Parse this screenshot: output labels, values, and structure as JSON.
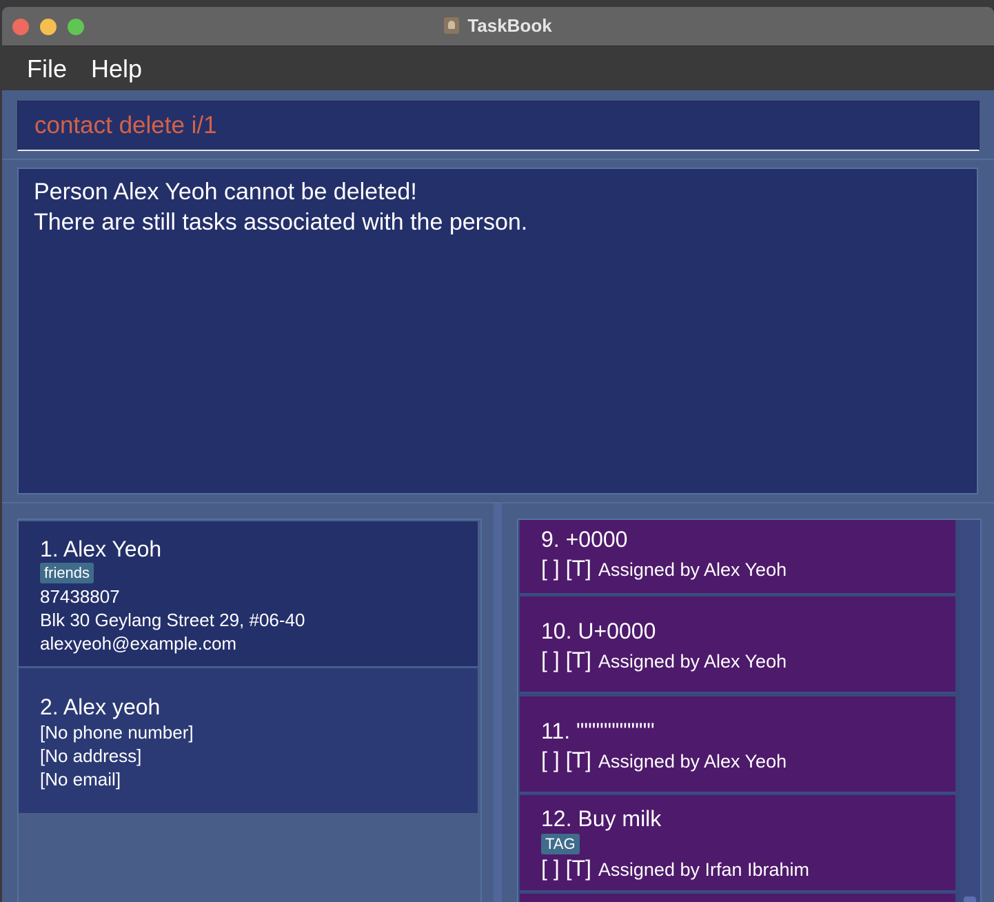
{
  "window": {
    "title": "TaskBook",
    "colors": {
      "background": "#485e88",
      "panel": "#24306a",
      "task_card": "#4e1a6b",
      "command_text": "#d46247"
    }
  },
  "menu": {
    "file": "File",
    "help": "Help"
  },
  "command": {
    "value": "contact delete i/1"
  },
  "result": {
    "line1": "Person Alex Yeoh cannot be deleted!",
    "line2": "There are still tasks associated with the person."
  },
  "persons": [
    {
      "name": "1.  Alex Yeoh",
      "tag": "friends",
      "phone": "87438807",
      "address": "Blk 30 Geylang Street 29, #06-40",
      "email": "alexyeoh@example.com"
    },
    {
      "name": "2.  Alex yeoh",
      "phone": "[No phone number]",
      "address": "[No address]",
      "email": "[No email]"
    }
  ],
  "tasks": [
    {
      "name": "9.  +0000",
      "status": "[ ]  [T]",
      "assigned": "Assigned by  Alex Yeoh"
    },
    {
      "name": "10.  U+0000",
      "status": "[ ]  [T]",
      "assigned": "Assigned by  Alex Yeoh"
    },
    {
      "name": "11.  \"\"\"\"\"\"\"\"\"\"",
      "status": "[ ]  [T]",
      "assigned": "Assigned by  Alex Yeoh"
    },
    {
      "name": "12.  Buy milk",
      "tag": "TAG",
      "status": "[ ]  [T]",
      "assigned": "Assigned by  Irfan Ibrahim"
    }
  ]
}
